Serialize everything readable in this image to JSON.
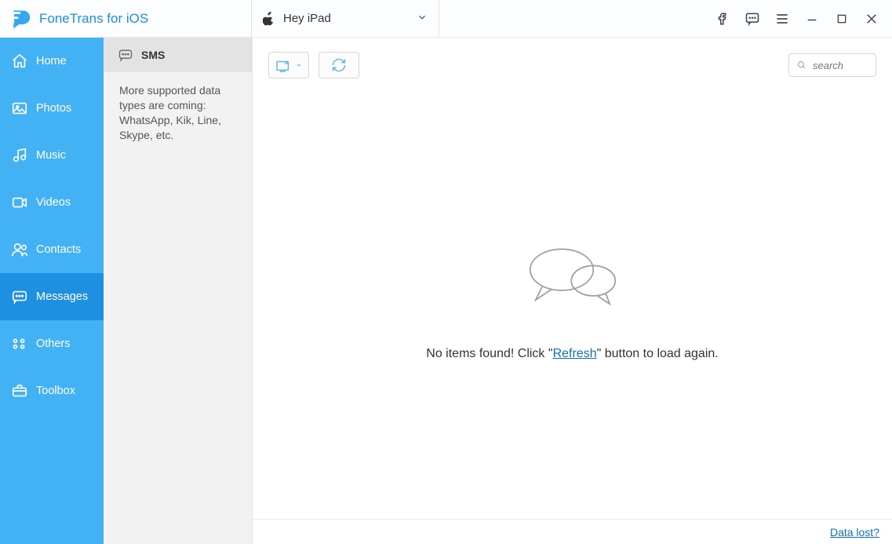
{
  "header": {
    "app_title": "FoneTrans for iOS",
    "device_name": "Hey iPad"
  },
  "sidebar": {
    "items": [
      {
        "label": "Home"
      },
      {
        "label": "Photos"
      },
      {
        "label": "Music"
      },
      {
        "label": "Videos"
      },
      {
        "label": "Contacts"
      },
      {
        "label": "Messages"
      },
      {
        "label": "Others"
      },
      {
        "label": "Toolbox"
      }
    ],
    "active_index": 5
  },
  "subpanel": {
    "items": [
      {
        "label": "SMS"
      }
    ],
    "info_text": "More supported data types are coming: WhatsApp, Kik, Line, Skype, etc."
  },
  "toolbar": {
    "search_placeholder": "search"
  },
  "empty_state": {
    "prefix": "No items found! Click \"",
    "link": "Refresh",
    "suffix": "\" button to load again."
  },
  "footer": {
    "data_lost": "Data lost?"
  }
}
